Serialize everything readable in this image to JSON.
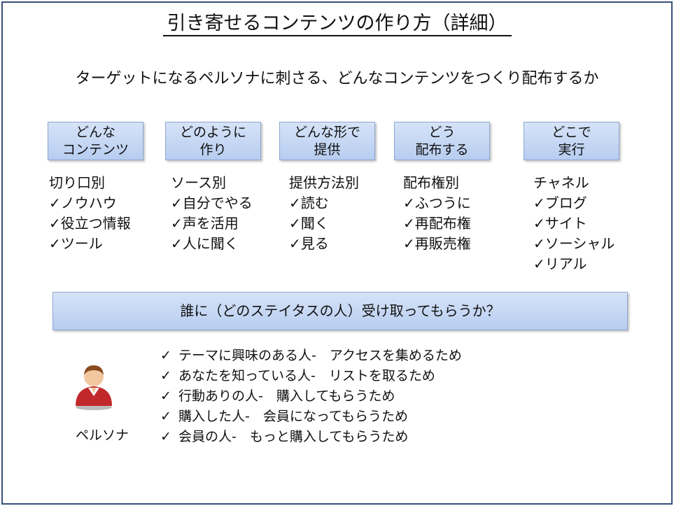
{
  "title": "引き寄せるコンテンツの作り方（詳細）",
  "subtitle": "ターゲットになるペルソナに刺さる、どんなコンテンツをつくり配布するか",
  "categories": [
    {
      "label_line1": "どんな",
      "label_line2": "コンテンツ",
      "heading": "切り口別",
      "items": [
        "✓ノウハウ",
        "✓役立つ情報",
        "✓ツール"
      ]
    },
    {
      "label_line1": "どのように",
      "label_line2": "作り",
      "heading": "ソース別",
      "items": [
        "✓自分でやる",
        "✓声を活用",
        "✓人に聞く"
      ]
    },
    {
      "label_line1": "どんな形で",
      "label_line2": "提供",
      "heading": "提供方法別",
      "items": [
        "✓読む",
        "✓聞く",
        "✓見る"
      ]
    },
    {
      "label_line1": "どう",
      "label_line2": "配布する",
      "heading": "配布権別",
      "items": [
        "✓ふつうに",
        "✓再配布権",
        "✓再販売権"
      ]
    },
    {
      "label_line1": "どこで",
      "label_line2": "実行",
      "heading": "チャネル",
      "items": [
        "✓ブログ",
        "✓サイト",
        "✓ソーシャル",
        "✓リアル"
      ]
    }
  ],
  "banner": "誰に（どのステイタスの人）受け取ってもらうか？",
  "persona": {
    "icon": "person-icon",
    "label": "ペルソナ"
  },
  "targets": [
    "テーマに興味のある人-　アクセスを集めるため",
    "あなたを知っている人-　リストを取るため",
    "行動ありの人-　購入してもらうため",
    "購入した人-　会員になってもらうため",
    "会員の人-　もっと購入してもらうため"
  ],
  "check_mark": "✓",
  "colors": {
    "box_fill_top": "#d6e3f8",
    "box_fill_bottom": "#b7cdf0",
    "box_border": "#8ea7cf",
    "frame_border": "#3a4f7a",
    "persona_shirt": "#c0282b"
  }
}
